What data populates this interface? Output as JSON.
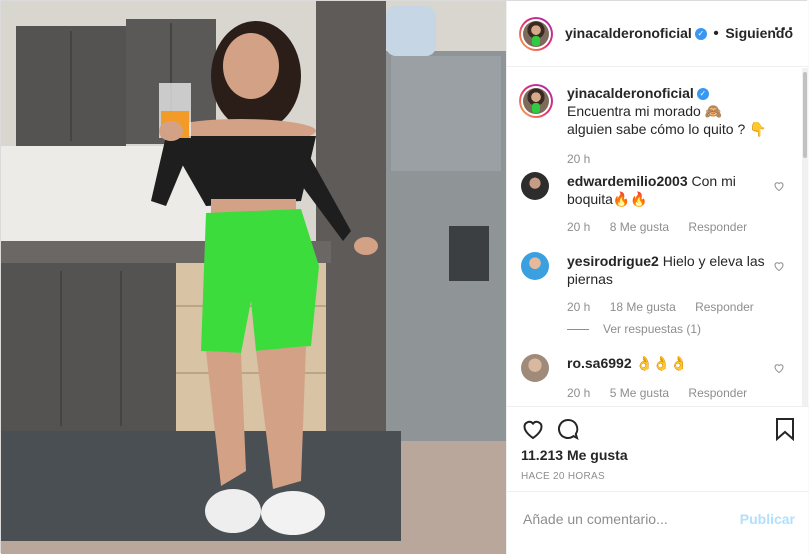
{
  "post": {
    "author": "yinacalderonoficial",
    "verified_icon": "verified-badge-icon",
    "dot": "•",
    "follow_status": "Siguiendo",
    "more_label": "···"
  },
  "caption": {
    "author": "yinacalderonoficial",
    "text": "Encuentra mi morado 🙈 alguien sabe cómo lo quito ? 👇",
    "time": "20 h"
  },
  "comments": [
    {
      "user": "edwardemilio2003",
      "text": "Con mi boquita🔥🔥",
      "time": "20 h",
      "likes": "8 Me gusta",
      "reply": "Responder"
    },
    {
      "user": "yesirodrigue2",
      "text": "Hielo y eleva las piernas",
      "time": "20 h",
      "likes": "18 Me gusta",
      "reply": "Responder",
      "view_replies": "Ver respuestas (1)"
    },
    {
      "user": "ro.sa6992",
      "text": "👌👌👌",
      "time": "20 h",
      "likes": "5 Me gusta",
      "reply": "Responder"
    }
  ],
  "actions": {
    "like_count": "11.213 Me gusta",
    "posted_ago": "HACE 20 HORAS"
  },
  "composer": {
    "placeholder": "Añade un comentario...",
    "publish": "Publicar"
  },
  "colors": {
    "accent_blue": "#3897f0",
    "publish_disabled": "#b2dffc",
    "shorts_green": "#3ddc3d"
  }
}
